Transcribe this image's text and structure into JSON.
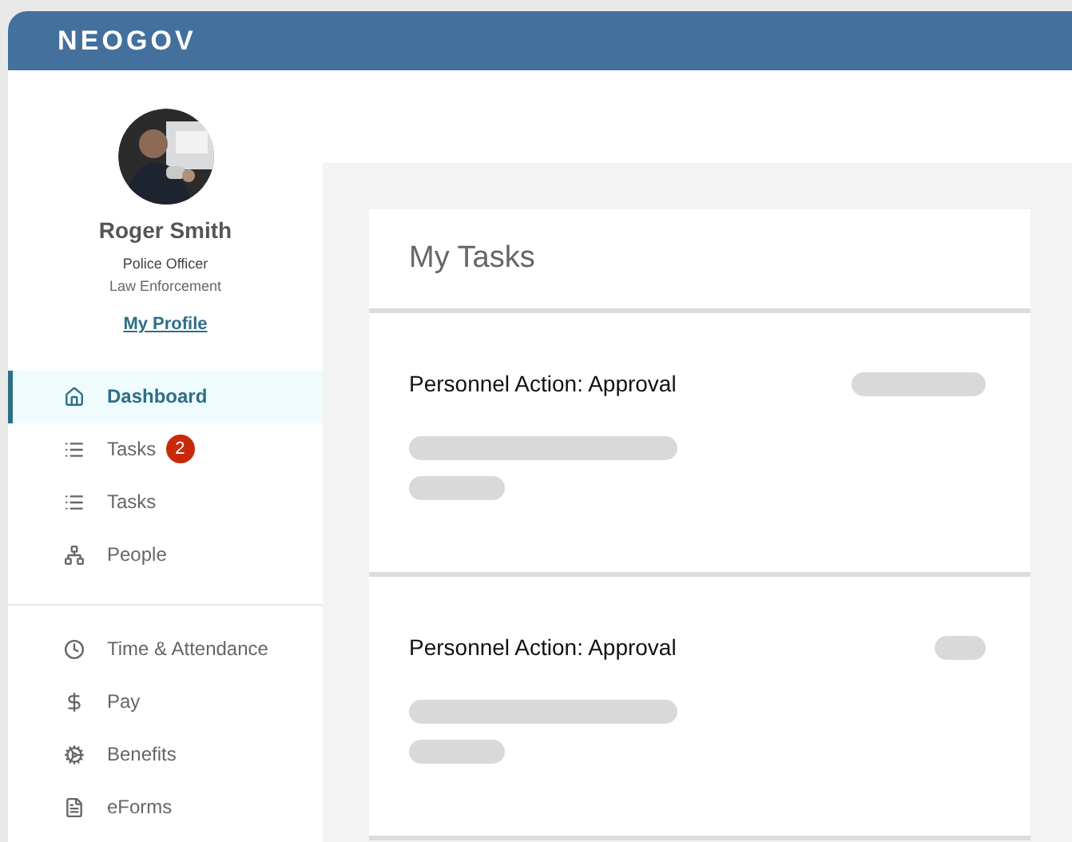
{
  "header": {
    "logo": "NEOGOV"
  },
  "profile": {
    "name": "Roger Smith",
    "title": "Police Officer",
    "department": "Law Enforcement",
    "link": "My Profile"
  },
  "nav_groups": [
    {
      "items": [
        {
          "label": "Dashboard",
          "selected": true
        },
        {
          "label": "Tasks",
          "selected": false,
          "badge": "2"
        },
        {
          "label": "Tasks",
          "selected": false
        },
        {
          "label": "People",
          "selected": false
        }
      ]
    },
    {
      "items": [
        {
          "label": "Time & Attendance",
          "selected": false
        },
        {
          "label": "Pay",
          "selected": false
        },
        {
          "label": "Benefits",
          "selected": false
        },
        {
          "label": "eForms",
          "selected": false
        }
      ]
    }
  ],
  "panel": {
    "title": "My Tasks",
    "tasks": [
      {
        "title": "Personnel Action: Approval",
        "kind": "wide"
      },
      {
        "title": "Personnel Action: Approval",
        "kind": "narrow"
      }
    ]
  }
}
